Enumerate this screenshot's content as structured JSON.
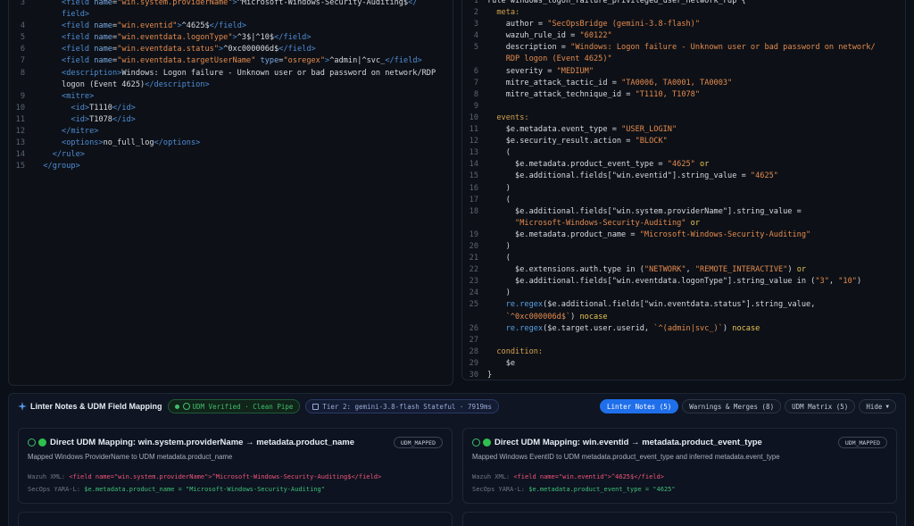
{
  "left_editor": {
    "lines": [
      {
        "n": "3",
        "html": "      <span class='tag'>&lt;field</span> <span class='attr'>name</span>=<span class='str'>\"win.system.providerName\"</span><span class='tag'>&gt;</span><span class='txt'>^Microsoft-Windows-Security-Auditing$</span><span class='tag'>&lt;/</span>"
      },
      {
        "n": "",
        "html": "      <span class='tag'>field&gt;</span>"
      },
      {
        "n": "4",
        "html": "      <span class='tag'>&lt;field</span> <span class='attr'>name</span>=<span class='str'>\"win.eventid\"</span><span class='tag'>&gt;</span><span class='txt'>^4625$</span><span class='tag'>&lt;/field&gt;</span>"
      },
      {
        "n": "5",
        "html": "      <span class='tag'>&lt;field</span> <span class='attr'>name</span>=<span class='str'>\"win.eventdata.logonType\"</span><span class='tag'>&gt;</span><span class='txt'>^3$|^10$</span><span class='tag'>&lt;/field&gt;</span>"
      },
      {
        "n": "6",
        "html": "      <span class='tag'>&lt;field</span> <span class='attr'>name</span>=<span class='str'>\"win.eventdata.status\"</span><span class='tag'>&gt;</span><span class='txt'>^0xc000006d$</span><span class='tag'>&lt;/field&gt;</span>"
      },
      {
        "n": "7",
        "html": "      <span class='tag'>&lt;field</span> <span class='attr'>name</span>=<span class='str'>\"win.eventdata.targetUserName\"</span> <span class='attr'>type</span>=<span class='str'>\"osregex\"</span><span class='tag'>&gt;</span><span class='txt'>^admin|^svc_</span><span class='tag'>&lt;/field&gt;</span>"
      },
      {
        "n": "8",
        "html": "      <span class='tag'>&lt;description&gt;</span><span class='txt'>Windows: Logon failure - Unknown user or bad password on network/RDP</span>"
      },
      {
        "n": "",
        "html": "      <span class='txt'>logon (Event 4625)</span><span class='tag'>&lt;/description&gt;</span>"
      },
      {
        "n": "9",
        "html": "      <span class='tag'>&lt;mitre&gt;</span>"
      },
      {
        "n": "10",
        "html": "        <span class='tag'>&lt;id&gt;</span><span class='txt'>T1110</span><span class='tag'>&lt;/id&gt;</span>"
      },
      {
        "n": "11",
        "html": "        <span class='tag'>&lt;id&gt;</span><span class='txt'>T1078</span><span class='tag'>&lt;/id&gt;</span>"
      },
      {
        "n": "12",
        "html": "      <span class='tag'>&lt;/mitre&gt;</span>"
      },
      {
        "n": "13",
        "html": "      <span class='tag'>&lt;options&gt;</span><span class='txt'>no_full_log</span><span class='tag'>&lt;/options&gt;</span>"
      },
      {
        "n": "14",
        "html": "    <span class='tag'>&lt;/rule&gt;</span>"
      },
      {
        "n": "15",
        "html": "  <span class='tag'>&lt;/group&gt;</span>"
      }
    ]
  },
  "right_editor": {
    "lines": [
      {
        "n": "1",
        "html": "<span class='txt'>rule windows_logon_failure_privileged_user_network_rdp {</span>"
      },
      {
        "n": "2",
        "html": "  <span class='kw'>meta:</span>"
      },
      {
        "n": "3",
        "html": "    <span class='txt'>author = </span><span class='str'>\"SecOpsBridge (gemini-3.8-flash)\"</span>"
      },
      {
        "n": "4",
        "html": "    <span class='txt'>wazuh_rule_id = </span><span class='str'>\"60122\"</span>"
      },
      {
        "n": "5",
        "html": "    <span class='txt'>description = </span><span class='str'>\"Windows: Logon failure - Unknown user or bad password on network/</span>"
      },
      {
        "n": "",
        "html": "    <span class='str'>RDP logon (Event 4625)\"</span>"
      },
      {
        "n": "6",
        "html": "    <span class='txt'>severity = </span><span class='str'>\"MEDIUM\"</span>"
      },
      {
        "n": "7",
        "html": "    <span class='txt'>mitre_attack_tactic_id = </span><span class='str'>\"TA0006, TA0001, TA0003\"</span>"
      },
      {
        "n": "8",
        "html": "    <span class='txt'>mitre_attack_technique_id = </span><span class='str'>\"T1110, T1078\"</span>"
      },
      {
        "n": "9",
        "html": ""
      },
      {
        "n": "10",
        "html": "  <span class='kw'>events:</span>"
      },
      {
        "n": "11",
        "html": "    <span class='txt'>$e.metadata.event_type = </span><span class='str'>\"USER_LOGIN\"</span>"
      },
      {
        "n": "12",
        "html": "    <span class='txt'>$e.security_result.action = </span><span class='str'>\"BLOCK\"</span>"
      },
      {
        "n": "13",
        "html": "    <span class='txt'>(</span>"
      },
      {
        "n": "14",
        "html": "      <span class='txt'>$e.metadata.product_event_type = </span><span class='str'>\"4625\"</span> <span class='op'>or</span>"
      },
      {
        "n": "15",
        "html": "      <span class='txt'>$e.additional.fields[\"win.eventid\"].string_value = </span><span class='str'>\"4625\"</span>"
      },
      {
        "n": "16",
        "html": "    <span class='txt'>)</span>"
      },
      {
        "n": "17",
        "html": "    <span class='txt'>(</span>"
      },
      {
        "n": "18",
        "html": "      <span class='txt'>$e.additional.fields[\"win.system.providerName\"].string_value =</span>"
      },
      {
        "n": "",
        "html": "      <span class='str'>\"Microsoft-Windows-Security-Auditing\"</span> <span class='op'>or</span>"
      },
      {
        "n": "19",
        "html": "      <span class='txt'>$e.metadata.product_name = </span><span class='str'>\"Microsoft-Windows-Security-Auditing\"</span>"
      },
      {
        "n": "20",
        "html": "    <span class='txt'>)</span>"
      },
      {
        "n": "21",
        "html": "    <span class='txt'>(</span>"
      },
      {
        "n": "22",
        "html": "      <span class='txt'>$e.extensions.auth.type in (</span><span class='str'>\"NETWORK\"</span><span class='txt'>, </span><span class='str'>\"REMOTE_INTERACTIVE\"</span><span class='txt'>) </span><span class='op'>or</span>"
      },
      {
        "n": "23",
        "html": "      <span class='txt'>$e.additional.fields[\"win.eventdata.logonType\"].string_value in (</span><span class='str'>\"3\"</span><span class='txt'>, </span><span class='str'>\"10\"</span><span class='txt'>)</span>"
      },
      {
        "n": "24",
        "html": "    <span class='txt'>)</span>"
      },
      {
        "n": "25",
        "html": "    <span class='fn'>re.regex</span><span class='txt'>($e.additional.fields[\"win.eventdata.status\"].string_value,</span>"
      },
      {
        "n": "",
        "html": "    <span class='str'>`^0xc000006d$`</span><span class='txt'>) </span><span class='op'>nocase</span>"
      },
      {
        "n": "26",
        "html": "    <span class='fn'>re.regex</span><span class='txt'>($e.target.user.userid, </span><span class='str'>`^(admin|svc_)`</span><span class='txt'>) </span><span class='op'>nocase</span>"
      },
      {
        "n": "27",
        "html": ""
      },
      {
        "n": "28",
        "html": "  <span class='kw'>condition:</span>"
      },
      {
        "n": "29",
        "html": "    <span class='txt'>$e</span>"
      },
      {
        "n": "30",
        "html": "<span class='txt'>}</span>"
      }
    ]
  },
  "bottom": {
    "title": "Linter Notes & UDM Field Mapping",
    "badge_verified": "UDM Verified · Clean Pipe",
    "badge_tier": "Tier 2: gemini-3.8-flash Stateful · 7919ms",
    "tabs": [
      "Linter Notes (5)",
      "Warnings & Merges (8)",
      "UDM Matrix (5)",
      "Hide"
    ]
  },
  "cards": [
    {
      "title": "Direct UDM Mapping: win.system.providerName → metadata.product_name",
      "tag": "UDM_MAPPED",
      "desc": "Mapped Windows ProviderName to UDM metadata.product_name",
      "wazuh_label": "Wazuh XML:",
      "wazuh_value": "<field name=\"win.system.providerName\">^Microsoft-Windows-Security-Auditing$</field>",
      "secops_label": "SecOps YARA-L:",
      "secops_value": "$e.metadata.product_name = \"Microsoft-Windows-Security-Auditing\""
    },
    {
      "title": "Direct UDM Mapping: win.eventid → metadata.product_event_type",
      "tag": "UDM_MAPPED",
      "desc": "Mapped Windows EventID to UDM metadata.product_event_type and inferred metadata.event_type",
      "wazuh_label": "Wazuh XML:",
      "wazuh_value": "<field name=\"win.eventid\">^4625$</field>",
      "secops_label": "SecOps YARA-L:",
      "secops_value": "$e.metadata.product_event_type = \"4625\""
    }
  ],
  "colors": {
    "accent": "#1f6feb",
    "success": "#3fbf6a",
    "danger": "#f2557a"
  }
}
